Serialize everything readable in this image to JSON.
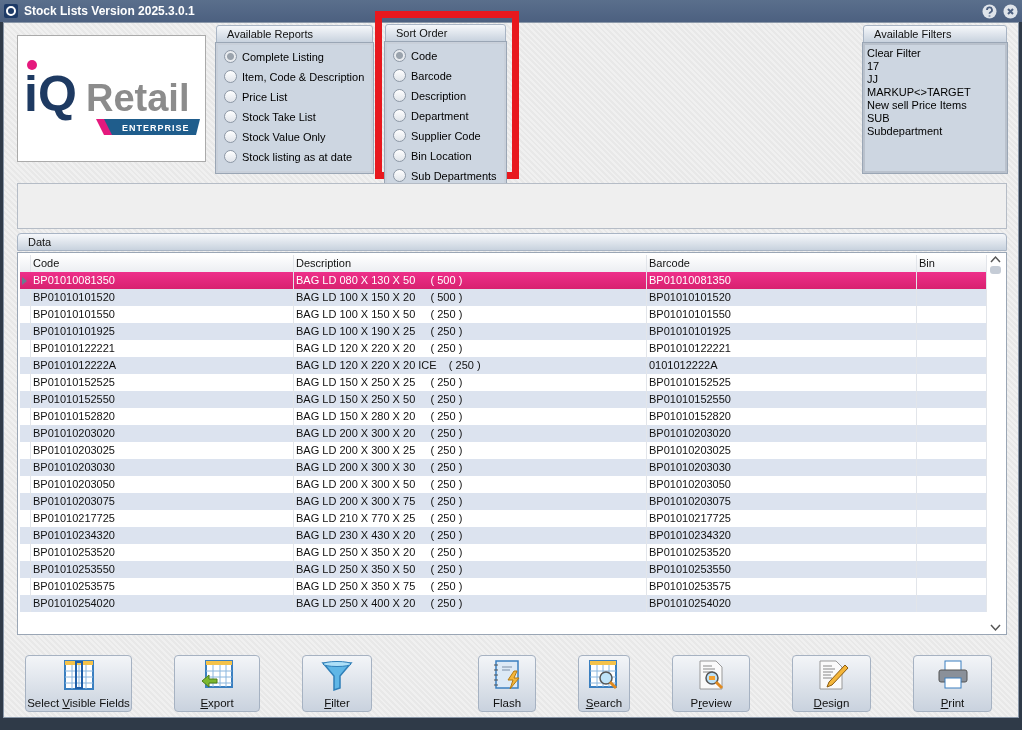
{
  "window": {
    "title": "Stock Lists Version 2025.3.0.1"
  },
  "logo": {
    "mark": "iQ",
    "name": "Retail",
    "tag": "ENTERPRISE"
  },
  "available_reports": {
    "title": "Available Reports",
    "items": [
      {
        "label": "Complete Listing",
        "selected": true
      },
      {
        "label": "Item, Code & Description",
        "selected": false
      },
      {
        "label": "Price List",
        "selected": false
      },
      {
        "label": "Stock Take List",
        "selected": false
      },
      {
        "label": "Stock Value Only",
        "selected": false
      },
      {
        "label": "Stock listing as at date",
        "selected": false
      }
    ]
  },
  "sort_order": {
    "title": "Sort Order",
    "highlighted": true,
    "items": [
      {
        "label": "Code",
        "selected": true
      },
      {
        "label": "Barcode",
        "selected": false
      },
      {
        "label": "Description",
        "selected": false
      },
      {
        "label": "Department",
        "selected": false
      },
      {
        "label": "Supplier Code",
        "selected": false
      },
      {
        "label": "Bin Location",
        "selected": false
      },
      {
        "label": "Sub Departments",
        "selected": false
      }
    ]
  },
  "available_filters": {
    "title": "Available Filters",
    "items": [
      "Clear Filter",
      "17",
      "JJ",
      "MARKUP<>TARGET",
      "New sell Price Items",
      "SUB",
      "Subdepartment"
    ]
  },
  "data": {
    "title": "Data",
    "columns": [
      "Code",
      "Description",
      "Barcode",
      "Bin"
    ],
    "rows": [
      {
        "cells": [
          "BP01010081350",
          "BAG LD 080 X 130 X 50     ( 500 )",
          "BP01010081350",
          ""
        ],
        "selected": true
      },
      {
        "cells": [
          "BP01010101520",
          "BAG LD 100 X 150 X 20     ( 500 )",
          "BP01010101520",
          ""
        ],
        "selected": false
      },
      {
        "cells": [
          "BP01010101550",
          "BAG LD 100 X 150 X 50     ( 250 )",
          "BP01010101550",
          ""
        ],
        "selected": false
      },
      {
        "cells": [
          "BP01010101925",
          "BAG LD 100 X 190 X 25     ( 250 )",
          "BP01010101925",
          ""
        ],
        "selected": false
      },
      {
        "cells": [
          "BP01010122221",
          "BAG LD 120 X 220 X 20     ( 250 )",
          "BP01010122221",
          ""
        ],
        "selected": false
      },
      {
        "cells": [
          "BP0101012222A",
          "BAG LD 120 X 220 X 20 ICE    ( 250 )",
          "0101012222A",
          ""
        ],
        "selected": false
      },
      {
        "cells": [
          "BP01010152525",
          "BAG LD 150 X 250 X 25     ( 250 )",
          "BP01010152525",
          ""
        ],
        "selected": false
      },
      {
        "cells": [
          "BP01010152550",
          "BAG LD 150 X 250 X 50     ( 250 )",
          "BP01010152550",
          ""
        ],
        "selected": false
      },
      {
        "cells": [
          "BP01010152820",
          "BAG LD 150 X 280 X 20     ( 250 )",
          "BP01010152820",
          ""
        ],
        "selected": false
      },
      {
        "cells": [
          "BP01010203020",
          "BAG LD 200 X 300 X 20     ( 250 )",
          "BP01010203020",
          ""
        ],
        "selected": false
      },
      {
        "cells": [
          "BP01010203025",
          "BAG LD 200 X 300 X 25     ( 250 )",
          "BP01010203025",
          ""
        ],
        "selected": false
      },
      {
        "cells": [
          "BP01010203030",
          "BAG LD 200 X 300 X 30     ( 250 )",
          "BP01010203030",
          ""
        ],
        "selected": false
      },
      {
        "cells": [
          "BP01010203050",
          "BAG LD 200 X 300 X 50     ( 250 )",
          "BP01010203050",
          ""
        ],
        "selected": false
      },
      {
        "cells": [
          "BP01010203075",
          "BAG LD 200 X 300 X 75     ( 250 )",
          "BP01010203075",
          ""
        ],
        "selected": false
      },
      {
        "cells": [
          "BP01010217725",
          "BAG LD 210 X 770 X 25     ( 250 )",
          "BP01010217725",
          ""
        ],
        "selected": false
      },
      {
        "cells": [
          "BP01010234320",
          "BAG LD 230 X 430 X 20     ( 250 )",
          "BP01010234320",
          ""
        ],
        "selected": false
      },
      {
        "cells": [
          "BP01010253520",
          "BAG LD 250 X 350 X 20     ( 250 )",
          "BP01010253520",
          ""
        ],
        "selected": false
      },
      {
        "cells": [
          "BP01010253550",
          "BAG LD 250 X 350 X 50     ( 250 )",
          "BP01010253550",
          ""
        ],
        "selected": false
      },
      {
        "cells": [
          "BP01010253575",
          "BAG LD 250 X 350 X 75     ( 250 )",
          "BP01010253575",
          ""
        ],
        "selected": false
      },
      {
        "cells": [
          "BP01010254020",
          "BAG LD 250 X 400 X 20     ( 250 )",
          "BP01010254020",
          ""
        ],
        "selected": false
      }
    ]
  },
  "buttons": [
    {
      "before": "Select ",
      "key": "V",
      "after": "isible Fields"
    },
    {
      "key": "E",
      "after": "xport"
    },
    {
      "key": "F",
      "after": "ilter"
    },
    {
      "before": "Flash"
    },
    {
      "key": "S",
      "after": "earch"
    },
    {
      "before": "P",
      "key": "r",
      "after": "eview"
    },
    {
      "key": "D",
      "after": "esign"
    },
    {
      "key": "P",
      "after": "rint"
    }
  ]
}
